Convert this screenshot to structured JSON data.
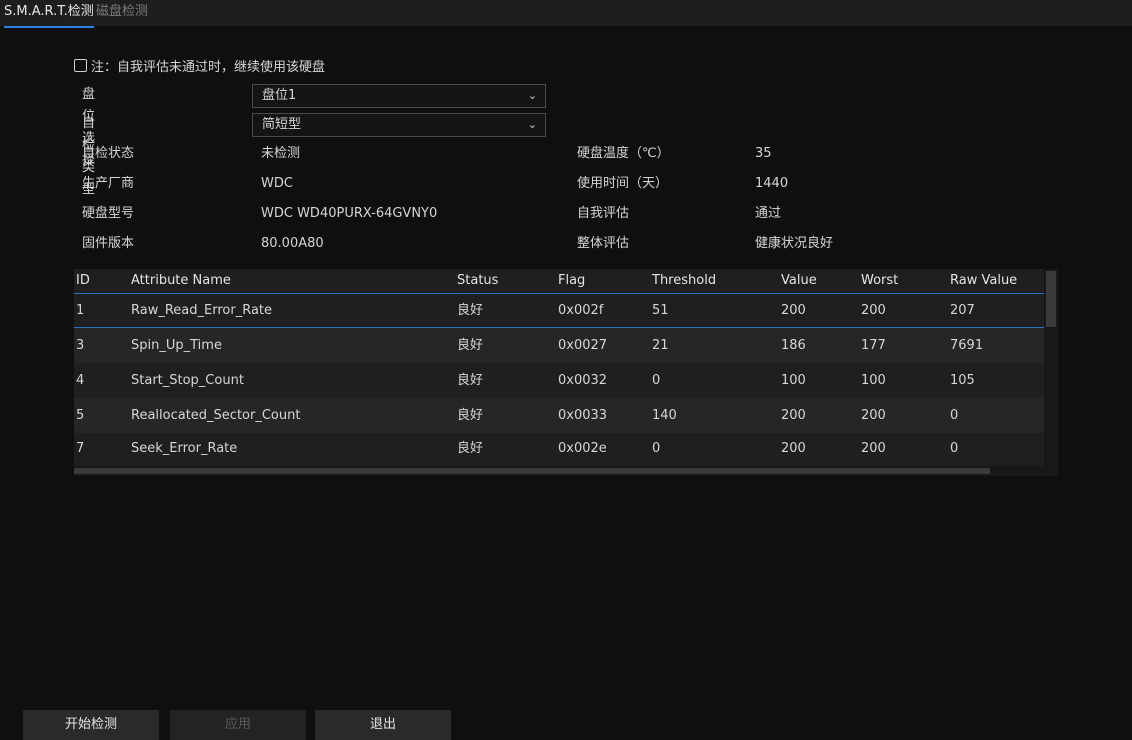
{
  "tabs": [
    {
      "label": "S.M.A.R.T.检测"
    },
    {
      "label": "磁盘检测"
    }
  ],
  "warning": {
    "label": "注：自我评估未通过时，继续使用该硬盘"
  },
  "fields": {
    "disk_select": {
      "label": "盘位选择",
      "value": "盘位1"
    },
    "test_type": {
      "label": "自检类型",
      "value": "简短型"
    },
    "test_status": {
      "label": "自检状态",
      "value": "未检测"
    },
    "manufacturer": {
      "label": "生产厂商",
      "value": "WDC"
    },
    "model": {
      "label": "硬盘型号",
      "value": "WDC WD40PURX-64GVNY0"
    },
    "firmware": {
      "label": "固件版本",
      "value": "80.00A80"
    },
    "temperature": {
      "label": "硬盘温度（℃）",
      "value": "35"
    },
    "usage_time": {
      "label": "使用时间（天）",
      "value": "1440"
    },
    "self_eval": {
      "label": "自我评估",
      "value": "通过"
    },
    "overall_eval": {
      "label": "整体评估",
      "value": "健康状况良好"
    }
  },
  "table": {
    "headers": {
      "id": "ID",
      "name": "Attribute Name",
      "status": "Status",
      "flag": "Flag",
      "threshold": "Threshold",
      "value": "Value",
      "worst": "Worst",
      "raw": "Raw Value"
    },
    "rows": [
      {
        "id": "1",
        "name": "Raw_Read_Error_Rate",
        "status": "良好",
        "flag": "0x002f",
        "threshold": "51",
        "value": "200",
        "worst": "200",
        "raw": "207"
      },
      {
        "id": "3",
        "name": "Spin_Up_Time",
        "status": "良好",
        "flag": "0x0027",
        "threshold": "21",
        "value": "186",
        "worst": "177",
        "raw": "7691"
      },
      {
        "id": "4",
        "name": "Start_Stop_Count",
        "status": "良好",
        "flag": "0x0032",
        "threshold": "0",
        "value": "100",
        "worst": "100",
        "raw": "105"
      },
      {
        "id": "5",
        "name": "Reallocated_Sector_Count",
        "status": "良好",
        "flag": "0x0033",
        "threshold": "140",
        "value": "200",
        "worst": "200",
        "raw": "0"
      },
      {
        "id": "7",
        "name": "Seek_Error_Rate",
        "status": "良好",
        "flag": "0x002e",
        "threshold": "0",
        "value": "200",
        "worst": "200",
        "raw": "0"
      }
    ]
  },
  "buttons": {
    "start": "开始检测",
    "apply": "应用",
    "exit": "退出"
  },
  "colors": {
    "accent": "#2d7fe0",
    "background": "#0f0f10"
  }
}
